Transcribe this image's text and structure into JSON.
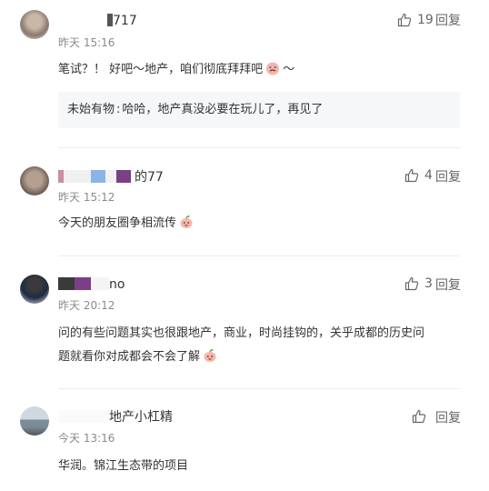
{
  "comments": [
    {
      "user": "717",
      "time": "昨天 15:16",
      "text": "笔试？！ 好吧～地产，咱们彻底拜拜吧",
      "text_suffix": "～",
      "likes": "19",
      "reply_label": "回复",
      "sub_reply": {
        "user": "未始有物",
        "text": "哈哈，地产真没必要在玩儿了，再见了"
      }
    },
    {
      "user": "的77",
      "time": "昨天 15:12",
      "text": "今天的朋友圈争相流传",
      "likes": "4",
      "reply_label": "回复"
    },
    {
      "user": "no",
      "time": "昨天 20:12",
      "text_line1": "问的有些问题其实也很跟地产，商业，时尚挂钩的，关乎成都的历史问",
      "text_line2": "题就看你对成都会不会了解",
      "likes": "3",
      "reply_label": "回复"
    },
    {
      "user": "地产小杠精",
      "time": "今天 13:16",
      "text": "华润。锦江生态带的项目",
      "reply_label": "回复"
    }
  ],
  "colors": {
    "text": "#333333",
    "meta": "#8a8a8a",
    "sub_bg": "#f6f7f9",
    "divider": "#ebebeb"
  },
  "icons": [
    "thumb-up-icon",
    "crying-emoji-icon",
    "peach-emoji-icon"
  ]
}
